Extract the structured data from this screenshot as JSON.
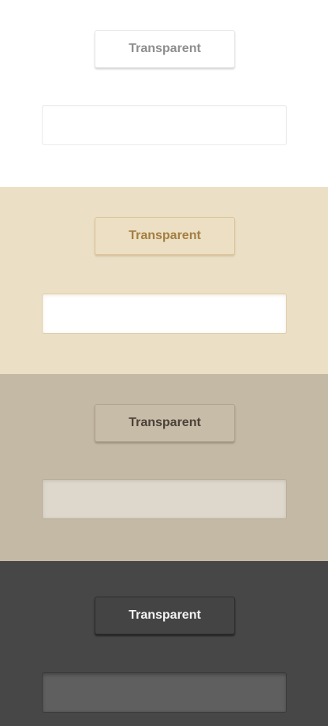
{
  "panels": [
    {
      "theme": "white",
      "background": "#ffffff",
      "button_label": "Transparent",
      "input_value": "",
      "input_placeholder": ""
    },
    {
      "theme": "cream",
      "background": "#ebdfc6",
      "button_label": "Transparent",
      "input_value": "",
      "input_placeholder": ""
    },
    {
      "theme": "taupe",
      "background": "#c4b9a4",
      "button_label": "Transparent",
      "input_value": "",
      "input_placeholder": ""
    },
    {
      "theme": "dark",
      "background": "#474747",
      "button_label": "Transparent",
      "input_value": "",
      "input_placeholder": ""
    }
  ]
}
